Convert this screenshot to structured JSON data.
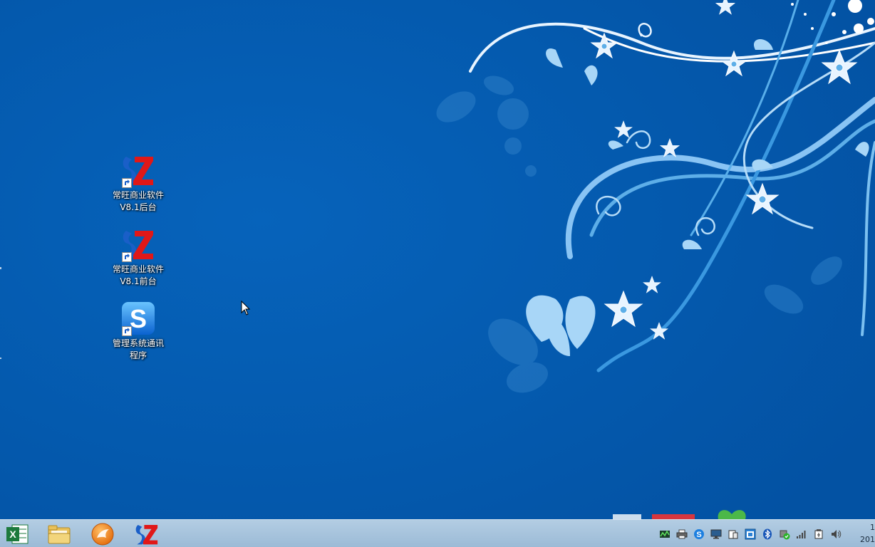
{
  "desktop": {
    "background_color": "#035aae",
    "icons": [
      {
        "name": "sz-backend",
        "label": "常旺商业软件V8.1后台",
        "icon": "sz-logo-icon"
      },
      {
        "name": "sz-frontend",
        "label": "常旺商业软件V8.1前台",
        "icon": "sz-logo-icon"
      },
      {
        "name": "comm-program",
        "label": "管理系统通讯程序",
        "icon": "blue-s-icon"
      }
    ]
  },
  "taskbar": {
    "pinned": [
      {
        "name": "excel",
        "icon": "excel-icon"
      },
      {
        "name": "explorer",
        "icon": "folder-icon"
      },
      {
        "name": "media",
        "icon": "orange-circle-icon"
      },
      {
        "name": "sz-app",
        "icon": "sz-logo-icon"
      }
    ],
    "tray_icons": [
      "network-activity-icon",
      "printer-icon",
      "s-app-icon",
      "monitor-icon",
      "device-icon",
      "app-window-icon",
      "bluetooth-icon",
      "security-icon",
      "signal-icon",
      "usb-icon",
      "volume-icon"
    ],
    "clock": {
      "time": "1",
      "date": "201"
    }
  }
}
